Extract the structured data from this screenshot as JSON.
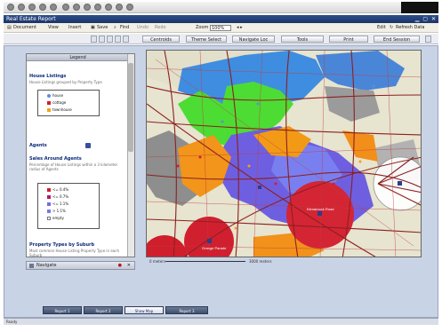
{
  "window": {
    "title": "Real Estate Report"
  },
  "menu": {
    "items": [
      "Document",
      "View",
      "Insert",
      "Save",
      "Find",
      "Undo",
      "Redo"
    ],
    "zoom_label": "Zoom",
    "zoom_value": "100%",
    "right_items": [
      "Edit",
      "Refresh Data"
    ]
  },
  "toolbar": {
    "buttons": [
      "Centroids",
      "Theme Select",
      "Navigate Loc",
      "Tools",
      "Print",
      "End Session"
    ]
  },
  "legend": {
    "title": "Legend",
    "house_listings": {
      "heading": "House Listings",
      "description": "House Listings grouped by Property Type",
      "items": [
        {
          "label": "house",
          "color": "#5b8fd8"
        },
        {
          "label": "cottage",
          "color": "#d01f2d"
        },
        {
          "label": "townhouse",
          "color": "#f2a21b"
        }
      ]
    },
    "agents": {
      "heading": "Agents"
    },
    "sales": {
      "heading": "Sales Around Agents",
      "description": "Percentage of House Listings within a 3 kilometer radius of Agents",
      "items": [
        {
          "label": "<= 0.4%",
          "color": "#d01f2d"
        },
        {
          "label": "<= 0.7%",
          "color": "#b2186a"
        },
        {
          "label": "<= 1.1%",
          "color": "#7c69d6"
        },
        {
          "label": "> 1.1%",
          "color": "#6d7ee8"
        },
        {
          "label": "empty",
          "color": "#ffffff"
        }
      ]
    },
    "property_types": {
      "heading": "Property Types by Suburb",
      "description": "Most common House Listing Property Type in each Suburb"
    }
  },
  "navigator": {
    "label": "Navigate"
  },
  "map": {
    "scale_left": "0 meters",
    "scale_right": "3000 meters",
    "agent_labels": [
      {
        "label": "Kilmarnock Road",
        "color": "#d01f2d"
      },
      {
        "label": "Grange Parade",
        "color": "#d01f2d"
      }
    ]
  },
  "tabs": [
    "Report 1",
    "Report 2",
    "Show Map",
    "Report 3"
  ],
  "status": "Ready"
}
